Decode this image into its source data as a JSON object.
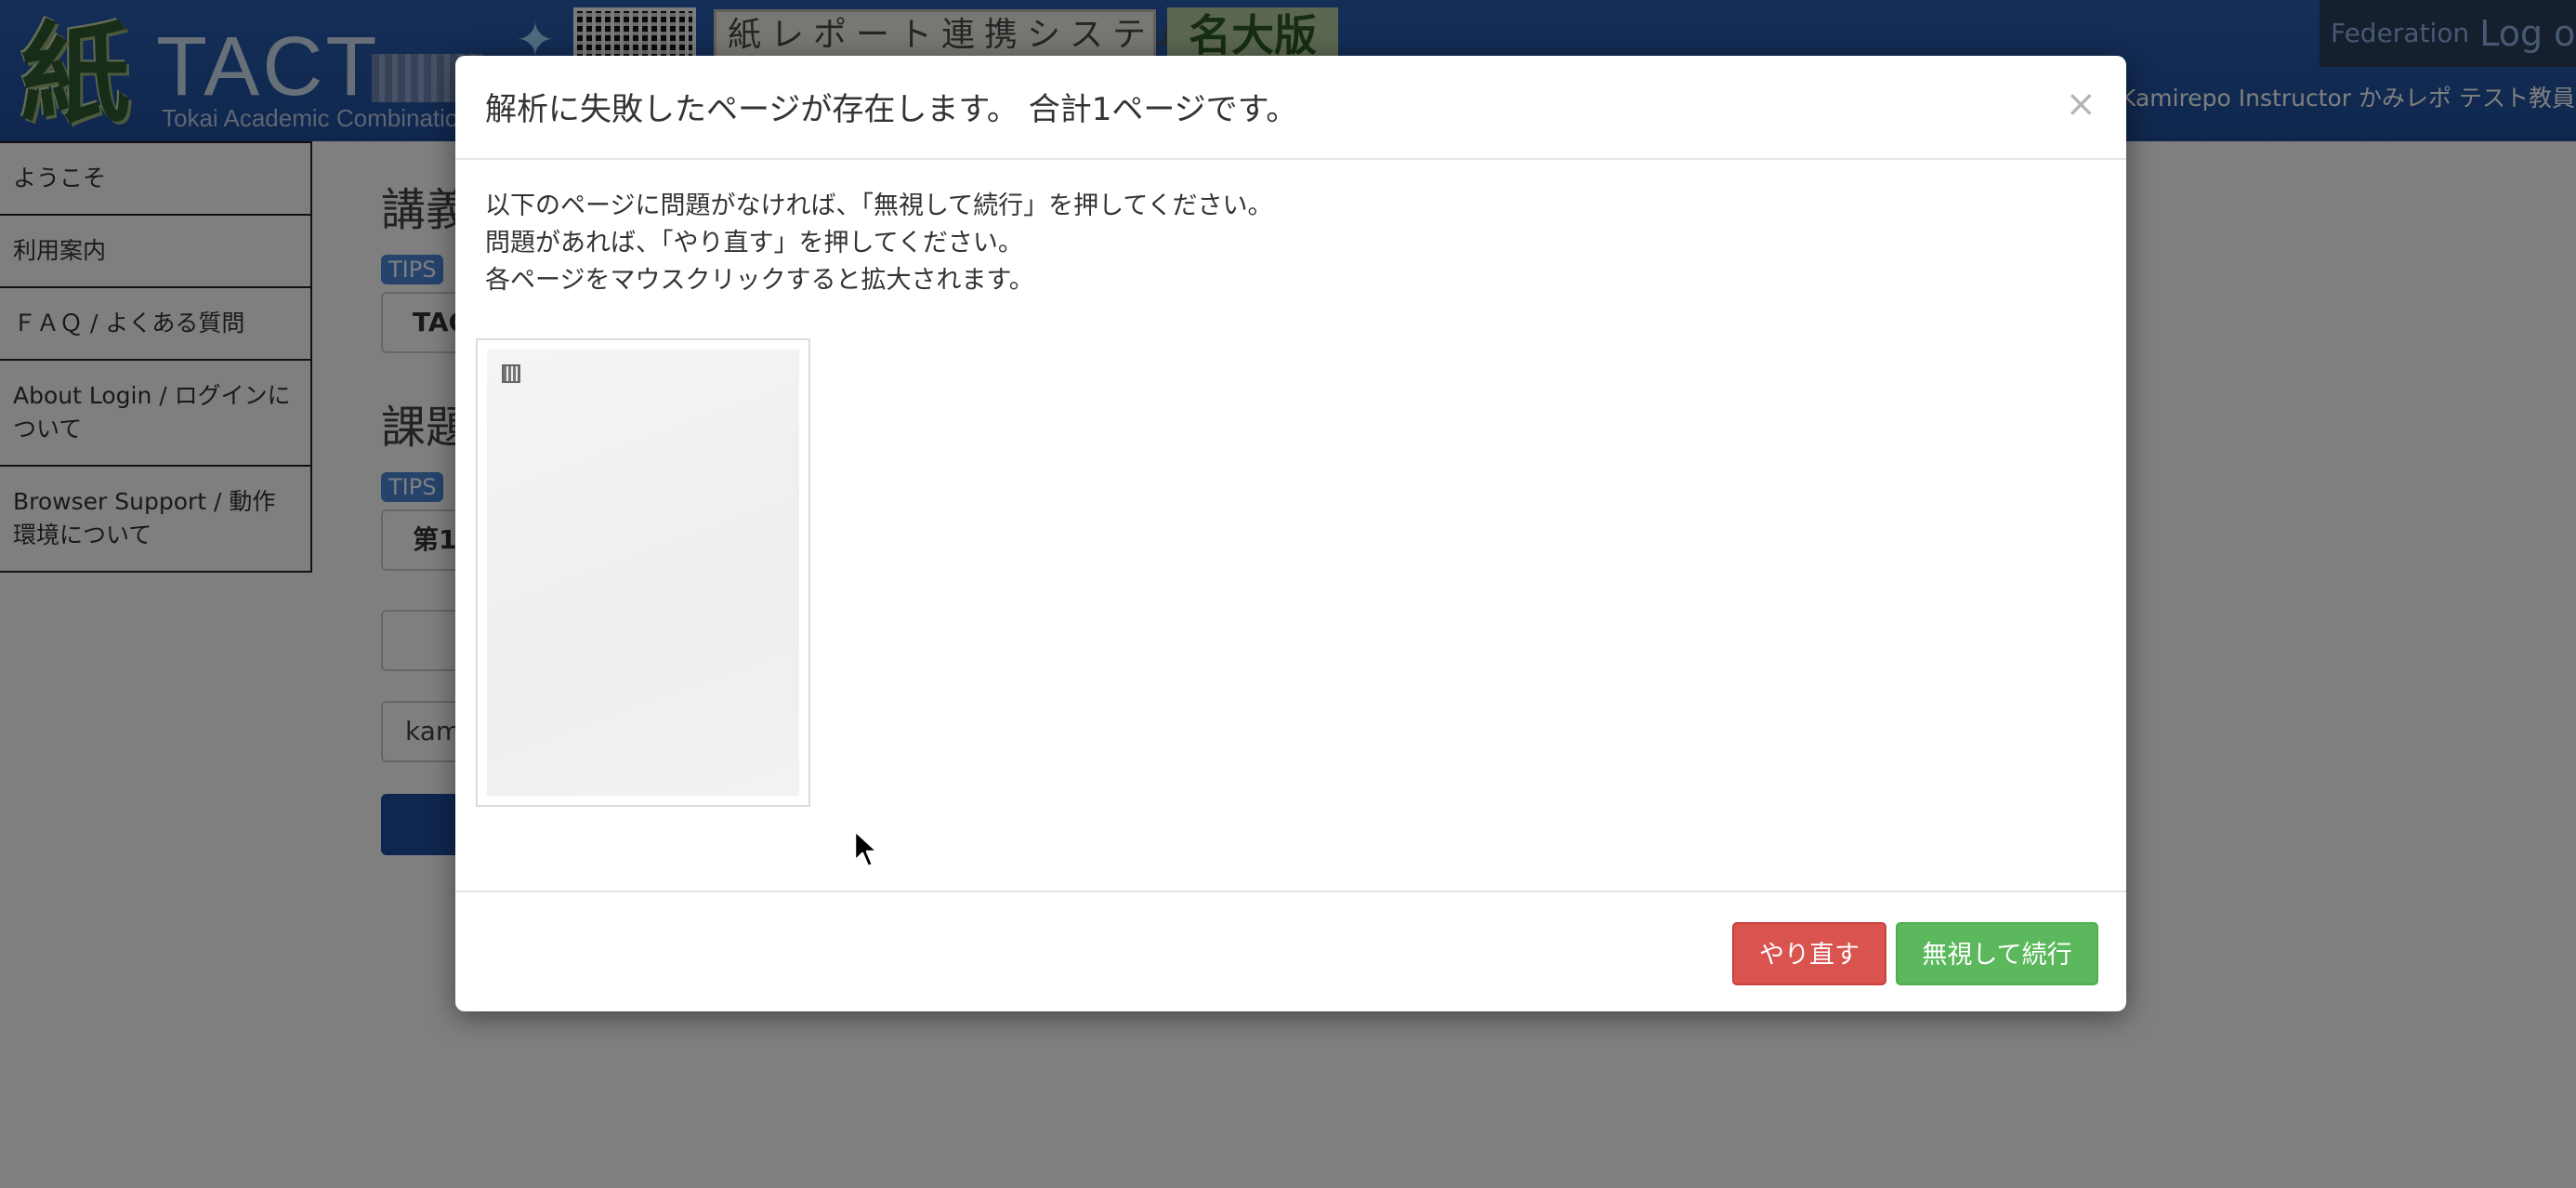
{
  "header": {
    "logo_kanji": "紙",
    "logo_title": "TACT",
    "logo_subtitle": "Tokai Academic Combinatio",
    "system_name": "紙レポート連携システム",
    "edition": "名大版",
    "federation_label": "Federation",
    "logout_label": "Log out",
    "user_name": "Kamirepo Instructor かみレポ テスト教員 さん"
  },
  "sidebar": {
    "items": [
      {
        "label": "ようこそ"
      },
      {
        "label": "利用案内"
      },
      {
        "label": "ＦＡＱ / よくある質問"
      },
      {
        "label": "About Login / ログインについて"
      },
      {
        "label": "Browser Support / 動作環境について"
      }
    ]
  },
  "main": {
    "heading_1": "講義",
    "tips_label": "TIPS",
    "box_1": "TAC",
    "heading_2": "課題",
    "box_2": "第1",
    "input_value": "kam"
  },
  "modal": {
    "title": "解析に失敗したページが存在します。 合計1ページです。",
    "close_symbol": "×",
    "instructions": [
      "以下のページに問題がなければ、「無視して続行」を押してください。",
      "問題があれば、「やり直す」を押してください。",
      "各ページをマウスクリックすると拡大されます。"
    ],
    "retry_label": "やり直す",
    "continue_label": "無視して続行"
  },
  "colors": {
    "header_bg": "#1f4f9c",
    "retry_button": "#d9534f",
    "continue_button": "#5cb85c",
    "overlay": "rgba(0,0,0,0.5)"
  }
}
